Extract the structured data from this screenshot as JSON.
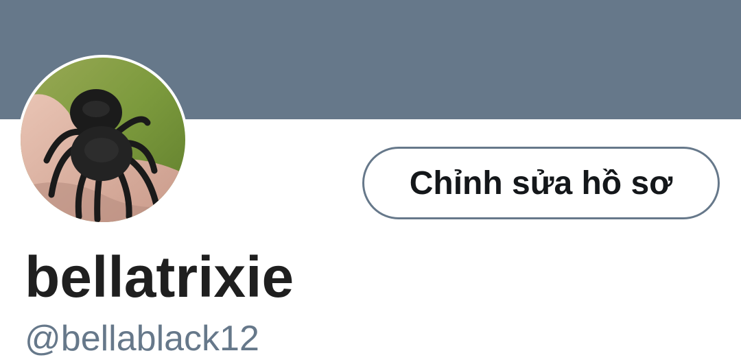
{
  "profile": {
    "display_name": "bellatrixie",
    "handle": "@bellablack12",
    "edit_button_label": "Chỉnh sửa hồ sơ",
    "avatar_icon": "tarantula-photo-avatar"
  },
  "colors": {
    "banner": "#66788a",
    "text_primary": "#1f1f1f",
    "text_secondary": "#66788a",
    "button_border": "#66788a"
  }
}
